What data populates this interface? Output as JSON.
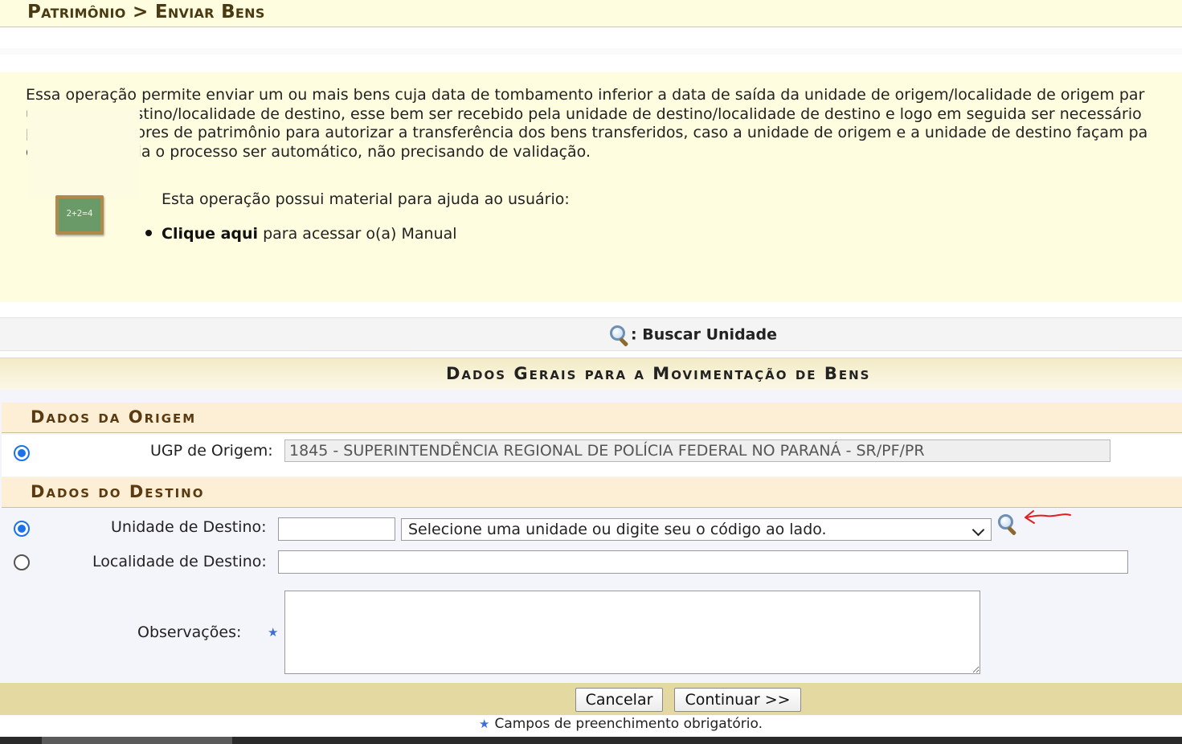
{
  "header": {
    "title": "Patrimônio > Enviar Bens"
  },
  "info": {
    "lines": [
      "Essa operação permite enviar um ou mais bens cuja data de tombamento inferior a data de saída da unidade de origem/localidade de origem par",
      "unidade de destino/localidade de destino, esse bem ser recebido pela unidade de destino/localidade de destino e logo em seguida ser necessário",
      "parte dos gestores de patrimônio para autorizar a transferência dos bens transferidos, caso a unidade de origem e a unidade de destino façam pa",
      "de transferência o processo ser automático, não precisando de validação."
    ],
    "help_intro": "Esta operação possui material para ajuda ao usuário:",
    "help_link": "Clique aqui",
    "help_link_suffix": " para acessar o(a) Manual",
    "chalkboard_text": "2+2=4"
  },
  "search_legend": {
    "label": ": Buscar Unidade",
    "icon": "magnifier-icon"
  },
  "form": {
    "caption": "Dados Gerais para a Movimentação de Bens",
    "origem": {
      "section_title": "Dados da Origem",
      "ugp_label": "UGP de Origem:",
      "ugp_value": "1845 - SUPERINTENDÊNCIA REGIONAL DE POLÍCIA FEDERAL NO PARANÁ - SR/PF/PR",
      "radio_checked": true
    },
    "destino": {
      "section_title": "Dados do Destino",
      "unidade_label": "Unidade de Destino:",
      "unidade_code_value": "",
      "unidade_select_value": "Selecione uma unidade ou digite seu o código ao lado.",
      "unidade_radio_checked": true,
      "localidade_label": "Localidade de Destino:",
      "localidade_value": "",
      "localidade_radio_checked": false,
      "observacoes_label": "Observações:",
      "observacoes_value": ""
    },
    "buttons": {
      "cancel": "Cancelar",
      "continue": "Continuar >>"
    },
    "required_note": "Campos de preenchimento obrigatório.",
    "required_symbol": "★"
  },
  "colors": {
    "header_bg": "#fffde0",
    "caption_text": "#222222",
    "subhead_text": "#5a3a10",
    "button_bar": "#e3d9a1",
    "annotation_arrow": "#e02020"
  }
}
